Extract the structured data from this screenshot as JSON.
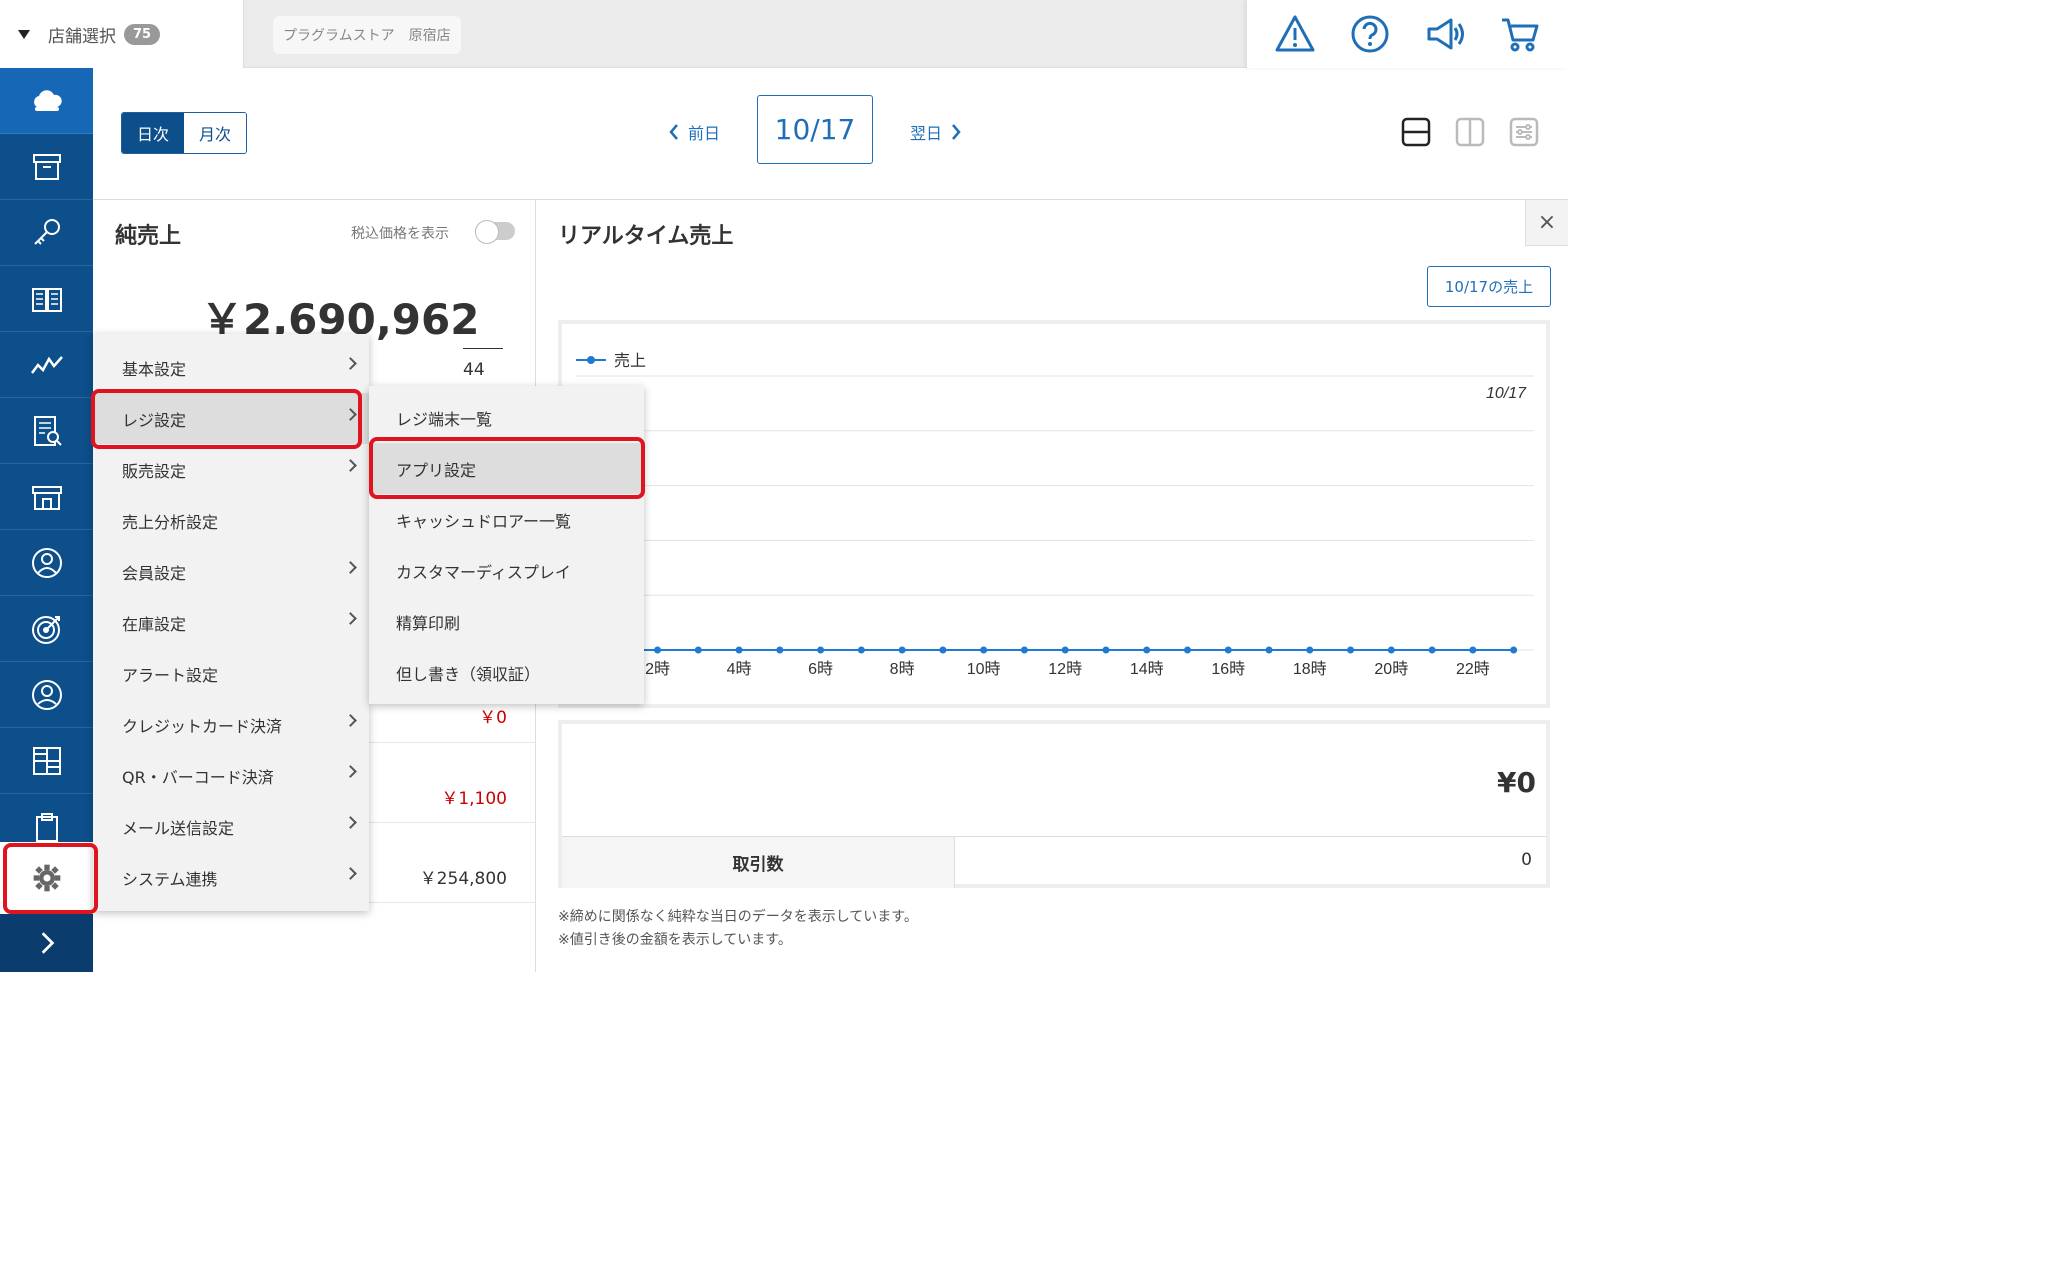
{
  "topbar": {
    "store_select_label": "店舗選択",
    "store_count": "75",
    "store_name": "プラグラムストア　原宿店"
  },
  "header": {
    "tab_daily": "日次",
    "tab_monthly": "月次",
    "prev_label": "前日",
    "date": "10/17",
    "next_label": "翌日"
  },
  "left_panel": {
    "title": "純売上",
    "tax_label": "税込価格を表示",
    "amount": "￥2,690,962",
    "sub_value": "44",
    "row_values": [
      "￥0",
      "￥1,100",
      "￥254,800"
    ]
  },
  "right_panel": {
    "title": "リアルタイム売上",
    "sales_button": "10/17の売上",
    "close_label": "×",
    "summary_amount": "¥0",
    "count_label": "取引数",
    "count_value": "0",
    "notes": [
      "※締めに関係なく純粋な当日のデータを表示しています。",
      "※値引き後の金額を表示しています。"
    ]
  },
  "chart_data": {
    "type": "line",
    "legend": [
      "売上"
    ],
    "annotation": "10/17",
    "x_tick_labels": [
      "2時",
      "4時",
      "6時",
      "8時",
      "10時",
      "12時",
      "14時",
      "16時",
      "18時",
      "20時",
      "22時"
    ],
    "series": [
      {
        "name": "売上",
        "x": [
          2,
          3,
          4,
          5,
          6,
          7,
          8,
          9,
          10,
          11,
          12,
          13,
          14,
          15,
          16,
          17,
          18,
          19,
          20,
          21,
          22,
          23
        ],
        "values": [
          0,
          0,
          0,
          0,
          0,
          0,
          0,
          0,
          0,
          0,
          0,
          0,
          0,
          0,
          0,
          0,
          0,
          0,
          0,
          0,
          0,
          0
        ]
      }
    ],
    "grid": true,
    "color": "#1f7ad1"
  },
  "menu": {
    "items": [
      {
        "label": "基本設定",
        "has_sub": true
      },
      {
        "label": "レジ設定",
        "has_sub": true
      },
      {
        "label": "販売設定",
        "has_sub": true
      },
      {
        "label": "売上分析設定",
        "has_sub": false
      },
      {
        "label": "会員設定",
        "has_sub": true
      },
      {
        "label": "在庫設定",
        "has_sub": true
      },
      {
        "label": "アラート設定",
        "has_sub": false
      },
      {
        "label": "クレジットカード決済",
        "has_sub": true
      },
      {
        "label": "QR・バーコード決済",
        "has_sub": true
      },
      {
        "label": "メール送信設定",
        "has_sub": true
      },
      {
        "label": "システム連携",
        "has_sub": true
      }
    ],
    "submenu": [
      "レジ端末一覧",
      "アプリ設定",
      "キャッシュドロアー一覧",
      "カスタマーディスプレイ",
      "精算印刷",
      "但し書き（領収証）"
    ]
  },
  "colors": {
    "sidebar": "#0d4f8b",
    "accent": "#1f6fb8",
    "highlight": "#e0141e"
  }
}
